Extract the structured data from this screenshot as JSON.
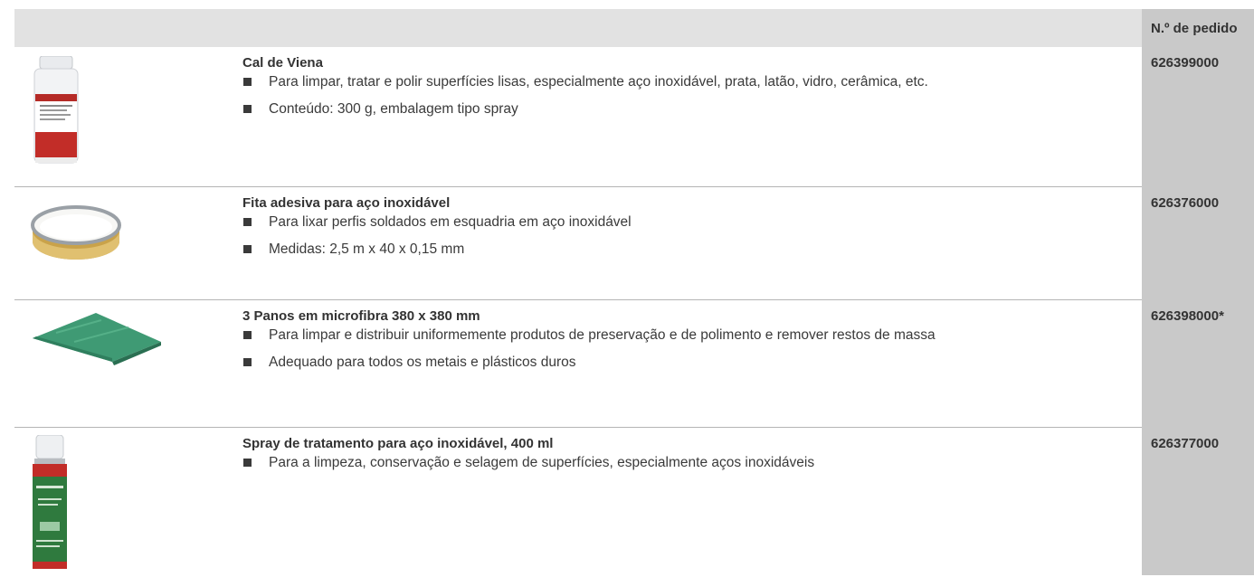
{
  "header": {
    "order_label": "N.º de pedido"
  },
  "products": [
    {
      "title": "Cal de Viena",
      "bullets": [
        "Para limpar, tratar e polir superfícies lisas, especialmente aço inoxidável, prata, latão, vidro, cerâmica, etc.",
        "Conteúdo: 300 g, embalagem tipo spray"
      ],
      "order_no": "626399000"
    },
    {
      "title": "Fita adesiva para aço inoxidável",
      "bullets": [
        "Para lixar perfis soldados em esquadria em aço inoxidável",
        "Medidas: 2,5 m x 40 x 0,15 mm"
      ],
      "order_no": "626376000"
    },
    {
      "title": "3 Panos em microfibra 380 x 380 mm",
      "bullets": [
        "Para limpar e distribuir uniformemente produtos de preservação e de polimento e remover restos de massa",
        "Adequado para todos os metais e plásticos duros"
      ],
      "order_no": "626398000*"
    },
    {
      "title": "Spray de tratamento para aço inoxidável, 400 ml",
      "bullets": [
        "Para a limpeza, conservação e selagem de superfícies, especialmente aços inoxidáveis"
      ],
      "order_no": "626377000"
    }
  ]
}
